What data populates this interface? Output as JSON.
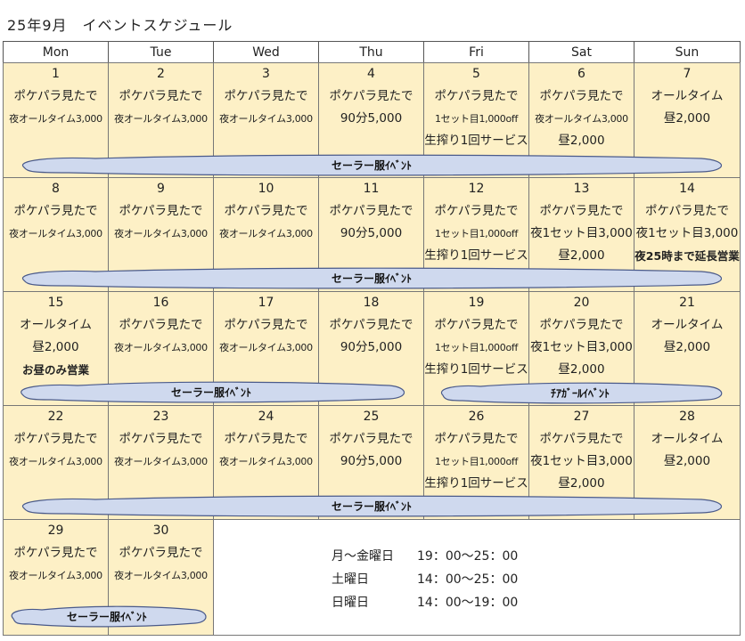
{
  "title": "25年9月　イベントスケジュール",
  "weekdays": [
    "Mon",
    "Tue",
    "Wed",
    "Thu",
    "Fri",
    "Sat",
    "Sun"
  ],
  "days": [
    {
      "n": "1",
      "lines": [
        "ポケパラ見たで",
        "夜オールタイム3,000"
      ]
    },
    {
      "n": "2",
      "lines": [
        "ポケパラ見たで",
        "夜オールタイム3,000"
      ]
    },
    {
      "n": "3",
      "lines": [
        "ポケパラ見たで",
        "夜オールタイム3,000"
      ]
    },
    {
      "n": "4",
      "lines": [
        "ポケパラ見たで",
        "90分5,000"
      ]
    },
    {
      "n": "5",
      "lines": [
        "ポケパラ見たで",
        "1セット目1,000off",
        "生搾り1回サービス"
      ]
    },
    {
      "n": "6",
      "lines": [
        "ポケパラ見たで",
        "夜オールタイム3,000",
        "昼2,000"
      ]
    },
    {
      "n": "7",
      "lines": [
        "オールタイム",
        "昼2,000"
      ]
    },
    {
      "n": "8",
      "lines": [
        "ポケパラ見たで",
        "夜オールタイム3,000"
      ]
    },
    {
      "n": "9",
      "lines": [
        "ポケパラ見たで",
        "夜オールタイム3,000"
      ]
    },
    {
      "n": "10",
      "lines": [
        "ポケパラ見たで",
        "夜オールタイム3,000"
      ]
    },
    {
      "n": "11",
      "lines": [
        "ポケパラ見たで",
        "90分5,000"
      ]
    },
    {
      "n": "12",
      "lines": [
        "ポケパラ見たで",
        "1セット目1,000off",
        "生搾り1回サービス"
      ]
    },
    {
      "n": "13",
      "lines": [
        "ポケパラ見たで",
        "夜1セット目3,000",
        "昼2,000"
      ]
    },
    {
      "n": "14",
      "lines": [
        "ポケパラ見たで",
        "夜1セット目3,000",
        "夜25時まで延長営業"
      ]
    },
    {
      "n": "15",
      "lines": [
        "オールタイム",
        "昼2,000",
        "お昼のみ営業"
      ]
    },
    {
      "n": "16",
      "lines": [
        "ポケパラ見たで",
        "夜オールタイム3,000"
      ]
    },
    {
      "n": "17",
      "lines": [
        "ポケパラ見たで",
        "夜オールタイム3,000"
      ]
    },
    {
      "n": "18",
      "lines": [
        "ポケパラ見たで",
        "90分5,000"
      ]
    },
    {
      "n": "19",
      "lines": [
        "ポケパラ見たで",
        "1セット目1,000off",
        "生搾り1回サービス"
      ]
    },
    {
      "n": "20",
      "lines": [
        "ポケパラ見たで",
        "夜1セット目3,000",
        "昼2,000"
      ]
    },
    {
      "n": "21",
      "lines": [
        "オールタイム",
        "昼2,000"
      ]
    },
    {
      "n": "22",
      "lines": [
        "ポケパラ見たで",
        "夜オールタイム3,000"
      ]
    },
    {
      "n": "23",
      "lines": [
        "ポケパラ見たで",
        "夜オールタイム3,000"
      ]
    },
    {
      "n": "24",
      "lines": [
        "ポケパラ見たで",
        "夜オールタイム3,000"
      ]
    },
    {
      "n": "25",
      "lines": [
        "ポケパラ見たで",
        "90分5,000"
      ]
    },
    {
      "n": "26",
      "lines": [
        "ポケパラ見たで",
        "1セット目1,000off",
        "生搾り1回サービス"
      ]
    },
    {
      "n": "27",
      "lines": [
        "ポケパラ見たで",
        "夜1セット目3,000",
        "昼2,000"
      ]
    },
    {
      "n": "28",
      "lines": [
        "オールタイム",
        "昼2,000"
      ]
    },
    {
      "n": "29",
      "lines": [
        "ポケパラ見たで",
        "夜オールタイム3,000"
      ]
    },
    {
      "n": "30",
      "lines": [
        "ポケパラ見たで",
        "夜オールタイム3,000"
      ]
    }
  ],
  "events": {
    "sailor": "セーラー服ｲﾍﾞﾝﾄ",
    "cheer": "ﾁｱｶﾞｰﾙｲﾍﾞﾝﾄ"
  },
  "hours": [
    {
      "day": "月～金曜日",
      "time": "19：00～25：00"
    },
    {
      "day": "土曜日",
      "time": "14：00～25：00"
    },
    {
      "day": "日曜日",
      "time": "14：00～19：00"
    }
  ],
  "colors": {
    "cell": "#fdf0c6",
    "cloud": "#cfd9ee",
    "cloud_border": "#4a5a8a"
  }
}
